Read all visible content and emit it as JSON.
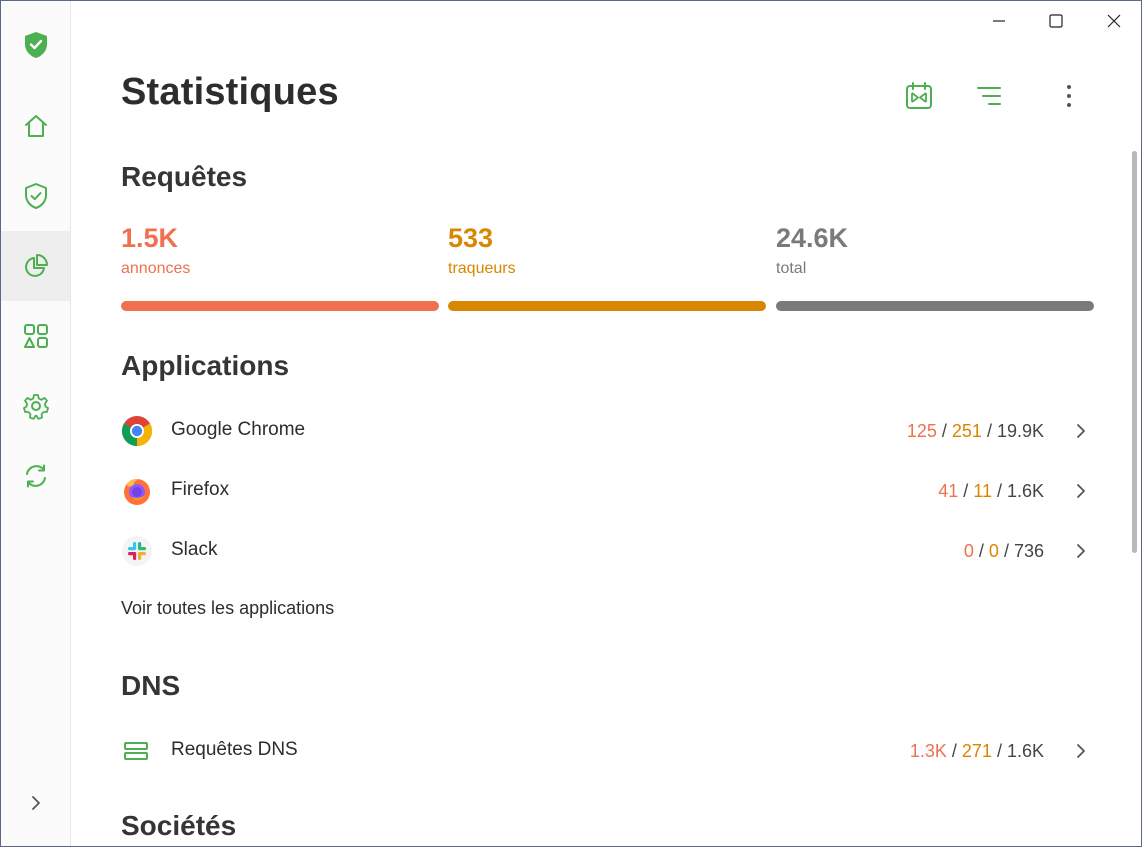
{
  "window": {
    "controls": [
      "minimize-icon",
      "maximize-icon",
      "close-icon"
    ]
  },
  "colors": {
    "brand": "#4caf50",
    "ads": "#f07050",
    "trackers": "#d88700",
    "total": "#7a7a7a"
  },
  "sidebar": {
    "items": [
      {
        "name": "home",
        "icon": "home-icon"
      },
      {
        "name": "protection",
        "icon": "shield-icon"
      },
      {
        "name": "statistics",
        "icon": "pie-chart-icon",
        "active": true
      },
      {
        "name": "apps",
        "icon": "apps-grid-icon"
      },
      {
        "name": "settings",
        "icon": "gear-icon"
      },
      {
        "name": "sync",
        "icon": "refresh-icon"
      }
    ],
    "expand_icon": "chevron-right-icon"
  },
  "header": {
    "title": "Statistiques",
    "actions": [
      "calendar-icon",
      "filter-icon",
      "more-vertical-icon"
    ]
  },
  "requests": {
    "title": "Requêtes",
    "stats": [
      {
        "value": "1.5K",
        "label": "annonces",
        "color": "#f07050"
      },
      {
        "value": "533",
        "label": "traqueurs",
        "color": "#d88700"
      },
      {
        "value": "24.6K",
        "label": "total",
        "color": "#7a7a7a"
      }
    ]
  },
  "applications": {
    "title": "Applications",
    "rows": [
      {
        "name": "Google Chrome",
        "icon": "chrome-icon",
        "ads": "125",
        "trackers": "251",
        "total": "19.9K"
      },
      {
        "name": "Firefox",
        "icon": "firefox-icon",
        "ads": "41",
        "trackers": "11",
        "total": "1.6K"
      },
      {
        "name": "Slack",
        "icon": "slack-icon",
        "ads": "0",
        "trackers": "0",
        "total": "736"
      }
    ],
    "see_all": "Voir toutes les applications"
  },
  "dns": {
    "title": "DNS",
    "rows": [
      {
        "name": "Requêtes DNS",
        "icon": "dns-server-icon",
        "ads": "1.3K",
        "trackers": "271",
        "total": "1.6K"
      }
    ]
  },
  "companies": {
    "title": "Sociétés"
  },
  "separator": " / "
}
